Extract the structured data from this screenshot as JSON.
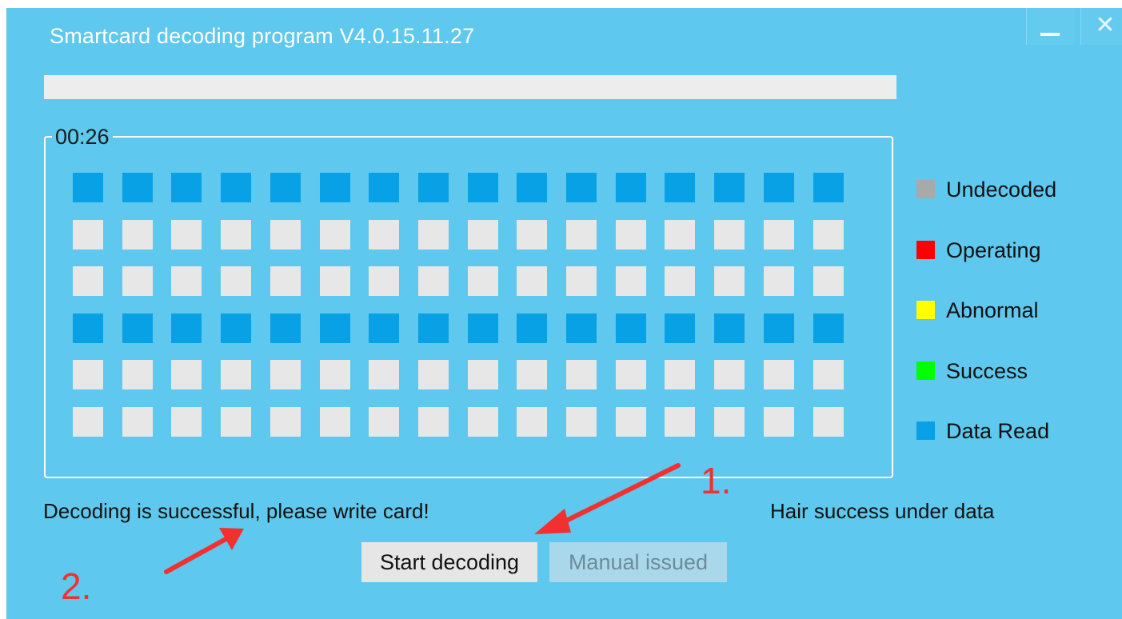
{
  "window": {
    "title": "Smartcard decoding program V4.0.15.11.27",
    "minimize_label": "—",
    "close_label": "✕"
  },
  "progress": {
    "value": 0,
    "fill_color": "#08a1e6"
  },
  "timer": {
    "label": "00:26"
  },
  "grid": {
    "columns": 16,
    "rows": [
      [
        "data_read",
        "data_read",
        "data_read",
        "data_read",
        "data_read",
        "data_read",
        "data_read",
        "data_read",
        "data_read",
        "data_read",
        "data_read",
        "data_read",
        "data_read",
        "data_read",
        "data_read",
        "data_read"
      ],
      [
        "idle",
        "idle",
        "idle",
        "idle",
        "idle",
        "idle",
        "idle",
        "idle",
        "idle",
        "idle",
        "idle",
        "idle",
        "idle",
        "idle",
        "idle",
        "idle"
      ],
      [
        "idle",
        "idle",
        "idle",
        "idle",
        "idle",
        "idle",
        "idle",
        "idle",
        "idle",
        "idle",
        "idle",
        "idle",
        "idle",
        "idle",
        "idle",
        "idle"
      ],
      [
        "data_read",
        "data_read",
        "data_read",
        "data_read",
        "data_read",
        "data_read",
        "data_read",
        "data_read",
        "data_read",
        "data_read",
        "data_read",
        "data_read",
        "data_read",
        "data_read",
        "data_read",
        "data_read"
      ],
      [
        "idle",
        "idle",
        "idle",
        "idle",
        "idle",
        "idle",
        "idle",
        "idle",
        "idle",
        "idle",
        "idle",
        "idle",
        "idle",
        "idle",
        "idle",
        "idle"
      ],
      [
        "idle",
        "idle",
        "idle",
        "idle",
        "idle",
        "idle",
        "idle",
        "idle",
        "idle",
        "idle",
        "idle",
        "idle",
        "idle",
        "idle",
        "idle",
        "idle"
      ]
    ],
    "colors": {
      "data_read": "#08a1e6",
      "idle": "#e7e7e7"
    }
  },
  "legend": [
    {
      "label": "Undecoded",
      "color": "#a9a9a9"
    },
    {
      "label": "Operating",
      "color": "#ff0000"
    },
    {
      "label": "Abnormal",
      "color": "#ffff00"
    },
    {
      "label": "Success",
      "color": "#00ff00"
    },
    {
      "label": "Data Read",
      "color": "#08a1e6"
    }
  ],
  "status": {
    "message": "Decoding is successful, please write card!",
    "right_message": "Hair success under data"
  },
  "buttons": {
    "start": "Start decoding",
    "manual": "Manual issued"
  },
  "annotations": {
    "step1": "1.",
    "step2": "2.",
    "color": "#f2302f"
  }
}
